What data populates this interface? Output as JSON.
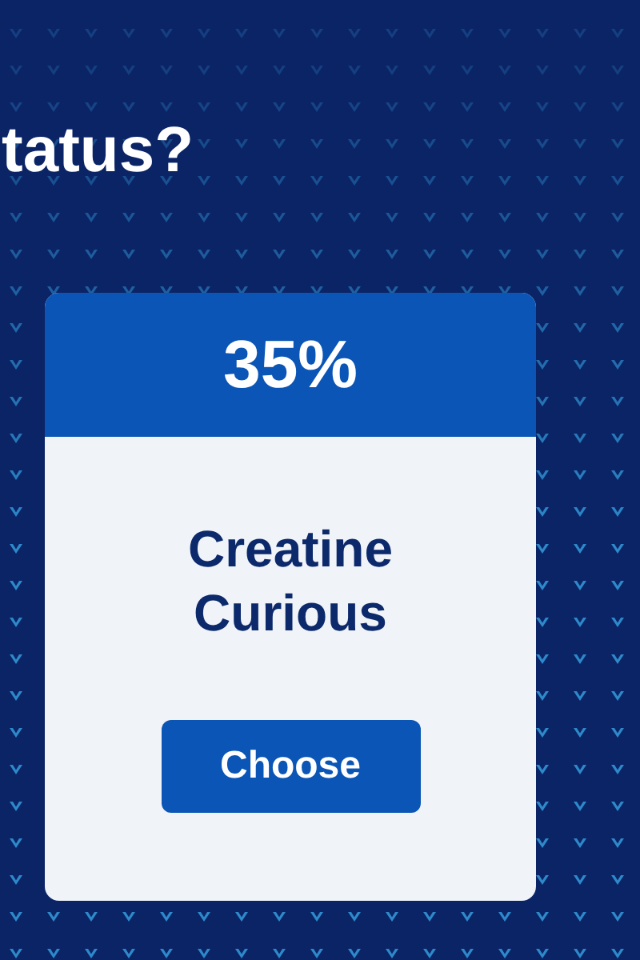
{
  "heading": "tatus?",
  "card": {
    "percent": "35%",
    "title": "Creatine Curious",
    "button": "Choose"
  }
}
